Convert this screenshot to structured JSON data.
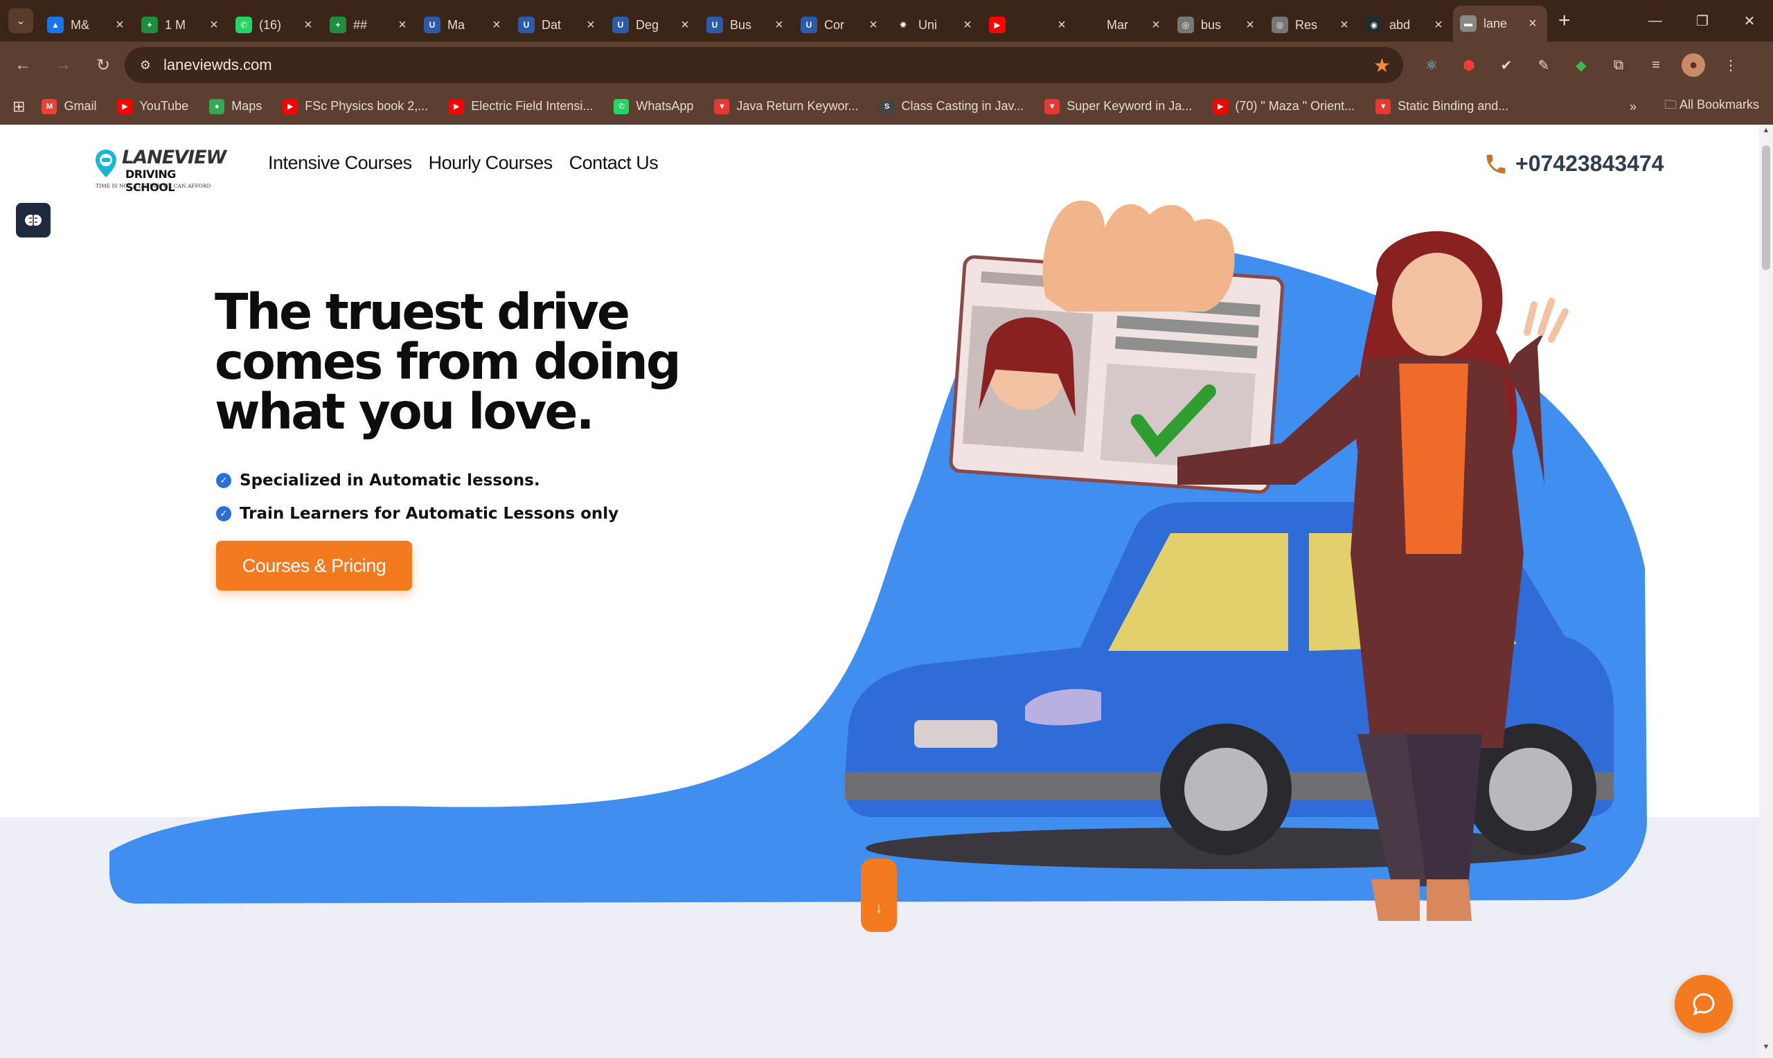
{
  "browser": {
    "tabs": [
      {
        "title": "M&",
        "color": "#1a73e8",
        "glyph": "▲"
      },
      {
        "title": "1 M",
        "color": "#1e8e3e",
        "glyph": "+"
      },
      {
        "title": "(16)",
        "color": "#25d366",
        "glyph": "✆"
      },
      {
        "title": "##",
        "color": "#1e8e3e",
        "glyph": "+"
      },
      {
        "title": "Ma",
        "color": "#2c5ba8",
        "glyph": "U"
      },
      {
        "title": "Dat",
        "color": "#2c5ba8",
        "glyph": "U"
      },
      {
        "title": "Deg",
        "color": "#2c5ba8",
        "glyph": "U"
      },
      {
        "title": "Bus",
        "color": "#2c5ba8",
        "glyph": "U"
      },
      {
        "title": "Cor",
        "color": "#2c5ba8",
        "glyph": "U"
      },
      {
        "title": "Uni",
        "color": "#3b2418",
        "glyph": "✺"
      },
      {
        "title": "",
        "color": "#ff0000",
        "glyph": "▶"
      },
      {
        "title": "Mar",
        "color": "#3b2418",
        "glyph": ""
      },
      {
        "title": "bus",
        "color": "#777777",
        "glyph": "◎"
      },
      {
        "title": "Res",
        "color": "#777777",
        "glyph": "◎"
      },
      {
        "title": "abd",
        "color": "#24292e",
        "glyph": "◉"
      },
      {
        "title": "lane",
        "color": "#888888",
        "glyph": "▬"
      }
    ],
    "url": "laneviewds.com",
    "bookmarks": [
      {
        "label": "Gmail",
        "color": "#ea4335",
        "glyph": "M"
      },
      {
        "label": "YouTube",
        "color": "#ff0000",
        "glyph": "▶"
      },
      {
        "label": "Maps",
        "color": "#34a853",
        "glyph": "●"
      },
      {
        "label": "FSc Physics book 2,...",
        "color": "#ff0000",
        "glyph": "▶"
      },
      {
        "label": "Electric Field Intensi...",
        "color": "#ff0000",
        "glyph": "▶"
      },
      {
        "label": "WhatsApp",
        "color": "#25d366",
        "glyph": "✆"
      },
      {
        "label": "Java Return Keywor...",
        "color": "#e53935",
        "glyph": "▼"
      },
      {
        "label": "Class Casting in Jav...",
        "color": "#444444",
        "glyph": "S"
      },
      {
        "label": "Super Keyword in Ja...",
        "color": "#e53935",
        "glyph": "▼"
      },
      {
        "label": "(70) \" Maza \" Orient...",
        "color": "#ff0000",
        "glyph": "▶"
      },
      {
        "label": "Static Binding and...",
        "color": "#e53935",
        "glyph": "▼"
      }
    ],
    "all_bookmarks": "All Bookmarks",
    "more": "»"
  },
  "site": {
    "logo": {
      "line1": "LANEVIEW",
      "line2": "DRIVING SCHOOL",
      "tagline": "TIME IS NOT A LUXURY WE CAN AFFORD"
    },
    "nav": [
      "Intensive Courses",
      "Hourly Courses",
      "Contact Us"
    ],
    "phone": "+07423843474",
    "hero": {
      "title": "The truest drive comes from doing what you love.",
      "bullets": [
        "Specialized in Automatic lessons.",
        "Train Learners for Automatic Lessons only"
      ],
      "cta": "Courses & Pricing"
    }
  },
  "colors": {
    "accent": "#f47a20",
    "hero_blue": "#3f8ef0",
    "check_blue": "#2a6fd6",
    "phone_icon": "#c0772a",
    "chrome_dark": "#3b2418",
    "chrome_mid": "#5c3f30"
  }
}
